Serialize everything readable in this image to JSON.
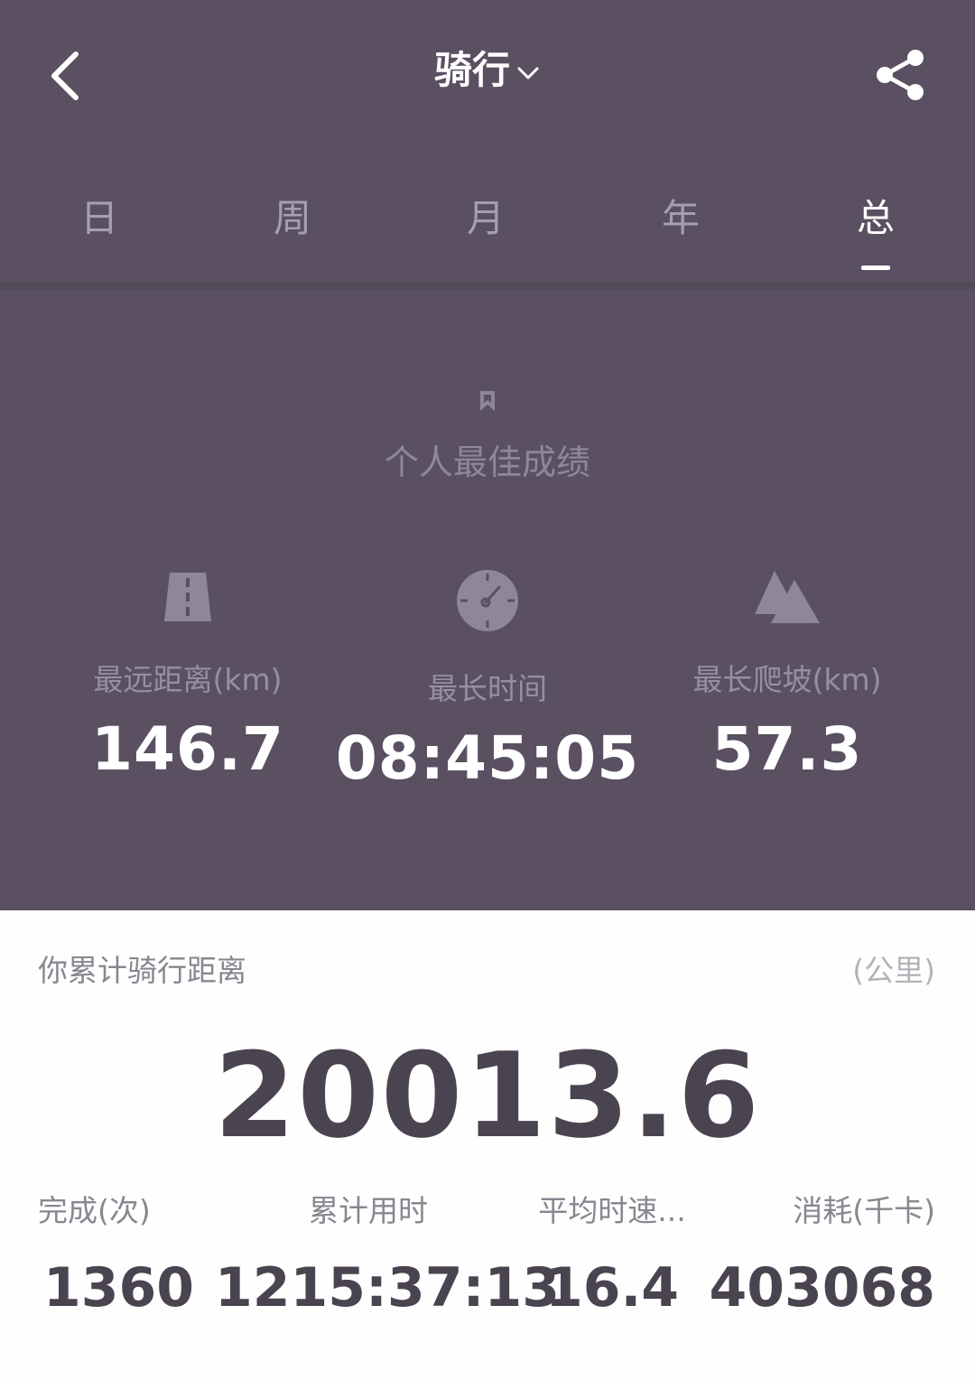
{
  "header": {
    "title": "骑行"
  },
  "tabs": [
    {
      "label": "日",
      "active": false
    },
    {
      "label": "周",
      "active": false
    },
    {
      "label": "月",
      "active": false
    },
    {
      "label": "年",
      "active": false
    },
    {
      "label": "总",
      "active": true
    }
  ],
  "personal_best": {
    "title": "个人最佳成绩",
    "stats": [
      {
        "icon": "road-icon",
        "label": "最远距离(km)",
        "value": "146.7"
      },
      {
        "icon": "stopwatch-icon",
        "label": "最长时间",
        "value": "08:45:05"
      },
      {
        "icon": "mountain-icon",
        "label": "最长爬坡(km)",
        "value": "57.3"
      }
    ]
  },
  "cumulative": {
    "label": "你累计骑行距离",
    "unit": "(公里)",
    "value": "20013.6",
    "stats": [
      {
        "label": "完成(次)",
        "value": "1360"
      },
      {
        "label": "累计用时",
        "value": "1215:37:13"
      },
      {
        "label": "平均时速...",
        "value": "16.4"
      },
      {
        "label": "消耗(千卡)",
        "value": "403068"
      }
    ]
  },
  "colors": {
    "header_bg": "#5a5062",
    "accent_text": "#ffffff",
    "muted_text": "#978f9f",
    "dark_value": "#4a4450"
  }
}
